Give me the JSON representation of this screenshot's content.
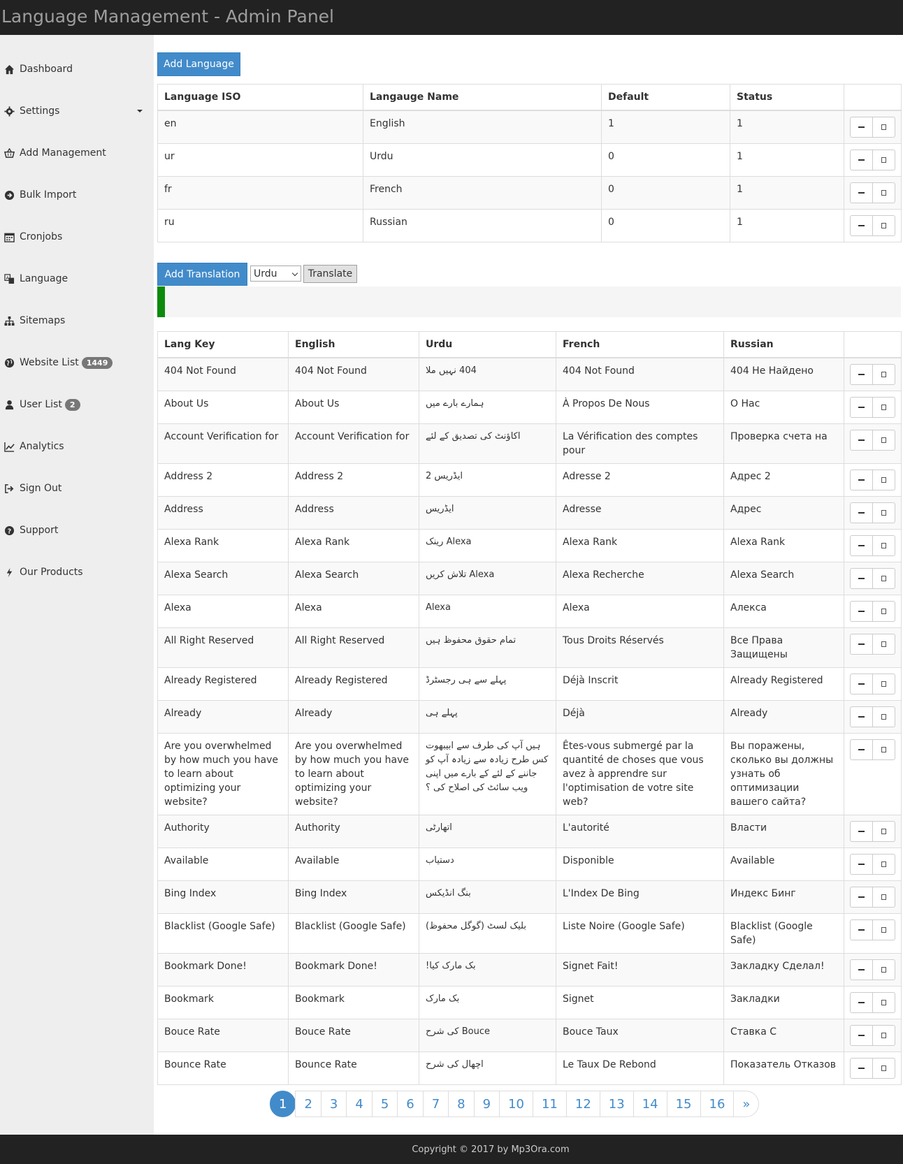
{
  "header": {
    "title": "Language Management - Admin Panel"
  },
  "sidebar": {
    "items": [
      {
        "label": "Dashboard",
        "icon": "home-icon"
      },
      {
        "label": "Settings",
        "icon": "gear-icon"
      },
      {
        "label": "Add Management",
        "icon": "basket-icon"
      },
      {
        "label": "Bulk Import",
        "icon": "circle-arrow-icon"
      },
      {
        "label": "Cronjobs",
        "icon": "calendar-icon"
      },
      {
        "label": "Language",
        "icon": "translate-icon"
      },
      {
        "label": "Sitemaps",
        "icon": "sitemap-icon"
      },
      {
        "label": "Website List",
        "icon": "globe-icon",
        "badge": "1449"
      },
      {
        "label": "User List",
        "icon": "user-icon",
        "badge": "2"
      },
      {
        "label": "Analytics",
        "icon": "chart-icon"
      },
      {
        "label": "Sign Out",
        "icon": "sign-out-icon"
      },
      {
        "label": "Support",
        "icon": "question-icon"
      },
      {
        "label": "Our Products",
        "icon": "bolt-icon"
      }
    ]
  },
  "languages": {
    "add_label": "Add Language",
    "headers": [
      "Language ISO",
      "Langauge Name",
      "Default",
      "Status",
      ""
    ],
    "rows": [
      [
        "en",
        "English",
        "1",
        "1"
      ],
      [
        "ur",
        "Urdu",
        "0",
        "1"
      ],
      [
        "fr",
        "French",
        "0",
        "1"
      ],
      [
        "ru",
        "Russian",
        "0",
        "1"
      ]
    ]
  },
  "translation": {
    "add_label": "Add Translation",
    "select_value": "Urdu",
    "translate_label": "Translate",
    "progress_fraction": 0.01,
    "progress_color": "#0c8a0c"
  },
  "translations": {
    "headers": [
      "Lang Key",
      "English",
      "Urdu",
      "French",
      "Russian",
      ""
    ],
    "rows": [
      [
        "404 Not Found",
        "404 Not Found",
        "404 نہیں ملا",
        "404 Not Found",
        "404 Не Найдено"
      ],
      [
        "About Us",
        "About Us",
        "ہمارے بارے میں",
        "À Propos De Nous",
        "О Нас"
      ],
      [
        "Account Verification for",
        "Account Verification for",
        "اکاؤنٹ کی تصدیق کے لئے",
        "La Vérification des comptes pour",
        "Проверка счета на"
      ],
      [
        "Address 2",
        "Address 2",
        "ایڈریس 2",
        "Adresse 2",
        "Адрес 2"
      ],
      [
        "Address",
        "Address",
        "ایڈریس",
        "Adresse",
        "Адрес"
      ],
      [
        "Alexa Rank",
        "Alexa Rank",
        "Alexa رینک",
        "Alexa Rank",
        "Alexa Rank"
      ],
      [
        "Alexa Search",
        "Alexa Search",
        "Alexa تلاش کریں",
        "Alexa Recherche",
        "Alexa Search"
      ],
      [
        "Alexa",
        "Alexa",
        "Alexa",
        "Alexa",
        "Алекса"
      ],
      [
        "All Right Reserved",
        "All Right Reserved",
        "تمام حقوق محفوظ ہیں",
        "Tous Droits Réservés",
        "Все Права Защищены"
      ],
      [
        "Already Registered",
        "Already Registered",
        "پہلے سے ہی رجسٹرڈ",
        "Déjà Inscrit",
        "Already Registered"
      ],
      [
        "Already",
        "Already",
        "پہلے ہی",
        "Déjà",
        "Already"
      ],
      [
        "Are you overwhelmed by how much you have to learn about optimizing your website?",
        "Are you overwhelmed by how much you have to learn about optimizing your website?",
        "ہیں آپ کی طرف سے ابیبھوت کس طرح زیادہ سے زیادہ آپ کو جاننے کے لئے کے بارے میں اپنی ویب سائٹ کی اصلاح کی ؟",
        "Êtes-vous submergé par la quantité de choses que vous avez à apprendre sur l'optimisation de votre site web?",
        "Вы поражены, сколько вы должны узнать об оптимизации вашего сайта?"
      ],
      [
        "Authority",
        "Authority",
        "اتھارٹی",
        "L'autorité",
        "Власти"
      ],
      [
        "Available",
        "Available",
        "دستیاب",
        "Disponible",
        "Available"
      ],
      [
        "Bing Index",
        "Bing Index",
        "بنگ انڈیکس",
        "L'Index De Bing",
        "Индекс Бинг"
      ],
      [
        "Blacklist (Google Safe)",
        "Blacklist (Google Safe)",
        "بلیک لسٹ (گوگل محفوظ)",
        "Liste Noire (Google Safe)",
        "Blacklist (Google Safe)"
      ],
      [
        "Bookmark Done!",
        "Bookmark Done!",
        "بک مارک کیا!",
        "Signet Fait!",
        "Закладку Сделал!"
      ],
      [
        "Bookmark",
        "Bookmark",
        "بک مارک",
        "Signet",
        "Закладки"
      ],
      [
        "Bouce Rate",
        "Bouce Rate",
        "Bouce کی شرح",
        "Bouce Taux",
        "Ставка С"
      ],
      [
        "Bounce Rate",
        "Bounce Rate",
        "اچھال کی شرح",
        "Le Taux De Rebond",
        "Показатель Отказов"
      ]
    ]
  },
  "pagination": {
    "pages": [
      "1",
      "2",
      "3",
      "4",
      "5",
      "6",
      "7",
      "8",
      "9",
      "10",
      "11",
      "12",
      "13",
      "14",
      "15",
      "16",
      "»"
    ],
    "active": "1"
  },
  "footer": {
    "text": "Copyright © 2017 by Mp3Ora.com"
  }
}
